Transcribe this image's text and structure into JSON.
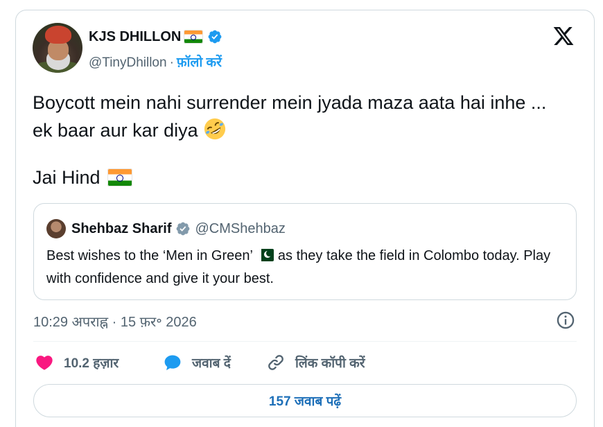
{
  "author": {
    "display_name": "KJS DHILLON",
    "handle": "@TinyDhillon",
    "separator": "·",
    "follow_label": "फ़ॉलो करें"
  },
  "tweet": {
    "text": "Boycott mein nahi surrender mein jyada maza aata hai inhe ... ek baar aur kar diya",
    "line2": "Jai Hind"
  },
  "quoted": {
    "name": "Shehbaz Sharif",
    "handle": "@CMShehbaz",
    "text_before_flag": "Best wishes to the ‘Men in Green’",
    "text_after_flag": "as they take the field in Colombo today. Play with confidence and give it your best."
  },
  "timestamp": "10:29 अपराह्न · 15 फ़र॰ 2026",
  "actions": {
    "like_count": "10.2 हज़ार",
    "reply_label": "जवाब दें",
    "copy_link_label": "लिंक कॉपी करें"
  },
  "read_replies_label": "157 जवाब पढ़ें",
  "colors": {
    "accent": "#1d9bf0",
    "like": "#f91880",
    "text": "#0f1419",
    "muted": "#536471",
    "border": "#cfd9de"
  },
  "icons": [
    "verified-badge-icon",
    "x-logo-icon",
    "rolling-laughing-emoji-icon",
    "india-flag-icon",
    "pakistan-flag-icon",
    "government-badge-icon",
    "info-icon",
    "heart-icon",
    "reply-bubble-icon",
    "link-icon"
  ]
}
